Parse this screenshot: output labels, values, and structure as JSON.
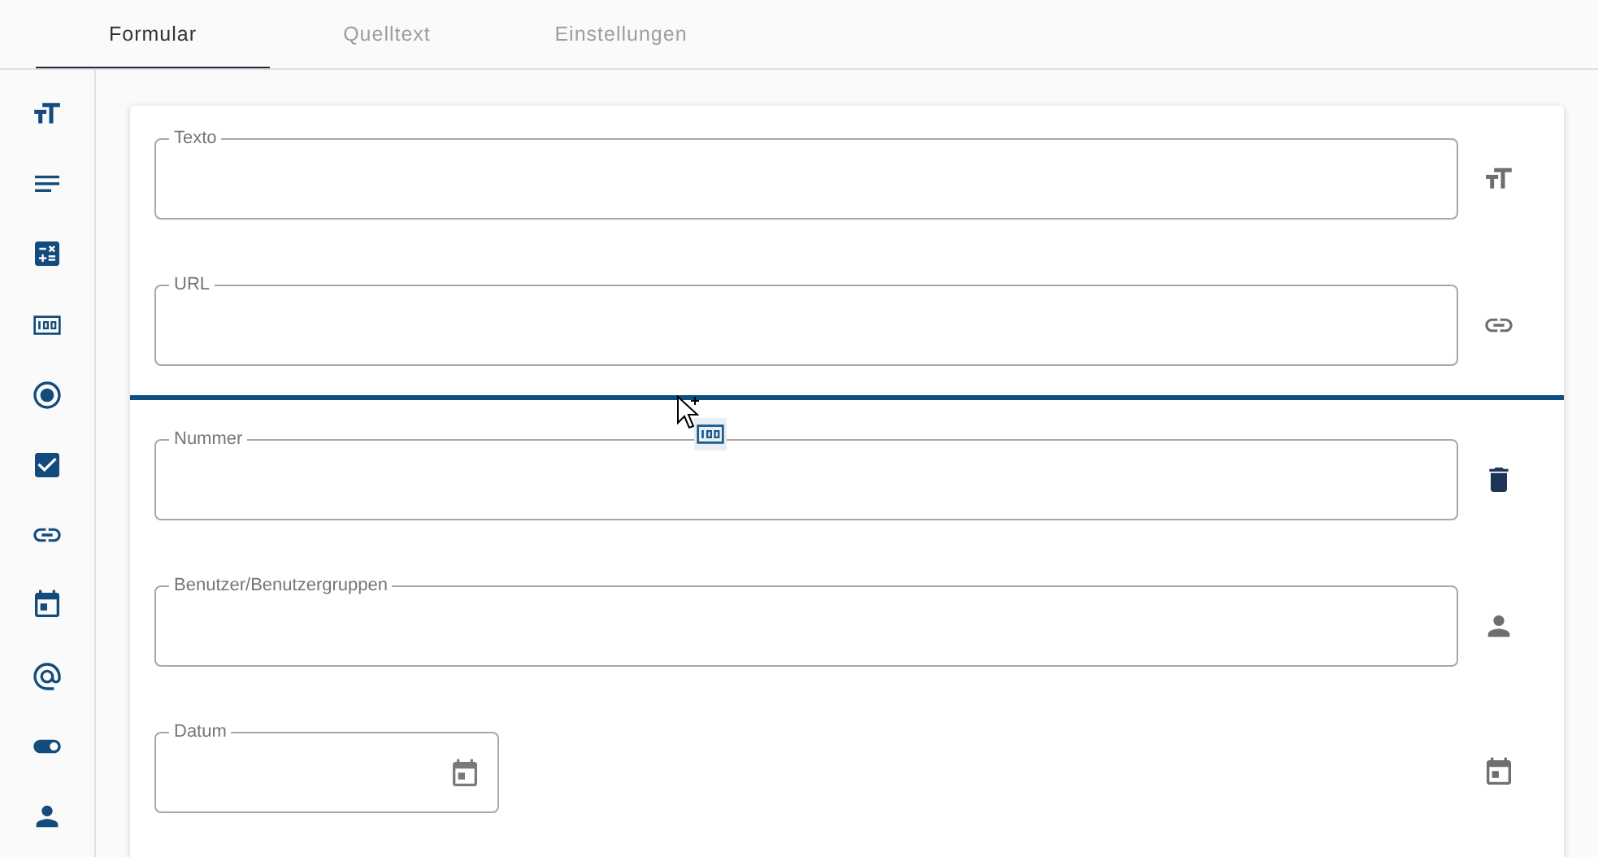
{
  "tabs": [
    {
      "label": "Formular",
      "selected": true
    },
    {
      "label": "Quelltext",
      "selected": false
    },
    {
      "label": "Einstellungen",
      "selected": false
    }
  ],
  "palette": [
    {
      "kind": "text"
    },
    {
      "kind": "textarea"
    },
    {
      "kind": "calculation"
    },
    {
      "kind": "number"
    },
    {
      "kind": "radio"
    },
    {
      "kind": "checkbox"
    },
    {
      "kind": "link"
    },
    {
      "kind": "date"
    },
    {
      "kind": "email"
    },
    {
      "kind": "toggle"
    },
    {
      "kind": "user"
    }
  ],
  "form": [
    {
      "kind": "text",
      "label": "Texto",
      "hovered": false
    },
    {
      "kind": "link",
      "label": "URL",
      "hovered": false
    },
    {
      "kind": "drop-marker",
      "dragging": {
        "kind": "number"
      }
    },
    {
      "kind": "number",
      "label": "Nummer",
      "hovered": true
    },
    {
      "kind": "user",
      "label": "Benutzer/Benutzergruppen",
      "hovered": false
    },
    {
      "kind": "date",
      "label": "Datum",
      "hovered": false
    }
  ]
}
